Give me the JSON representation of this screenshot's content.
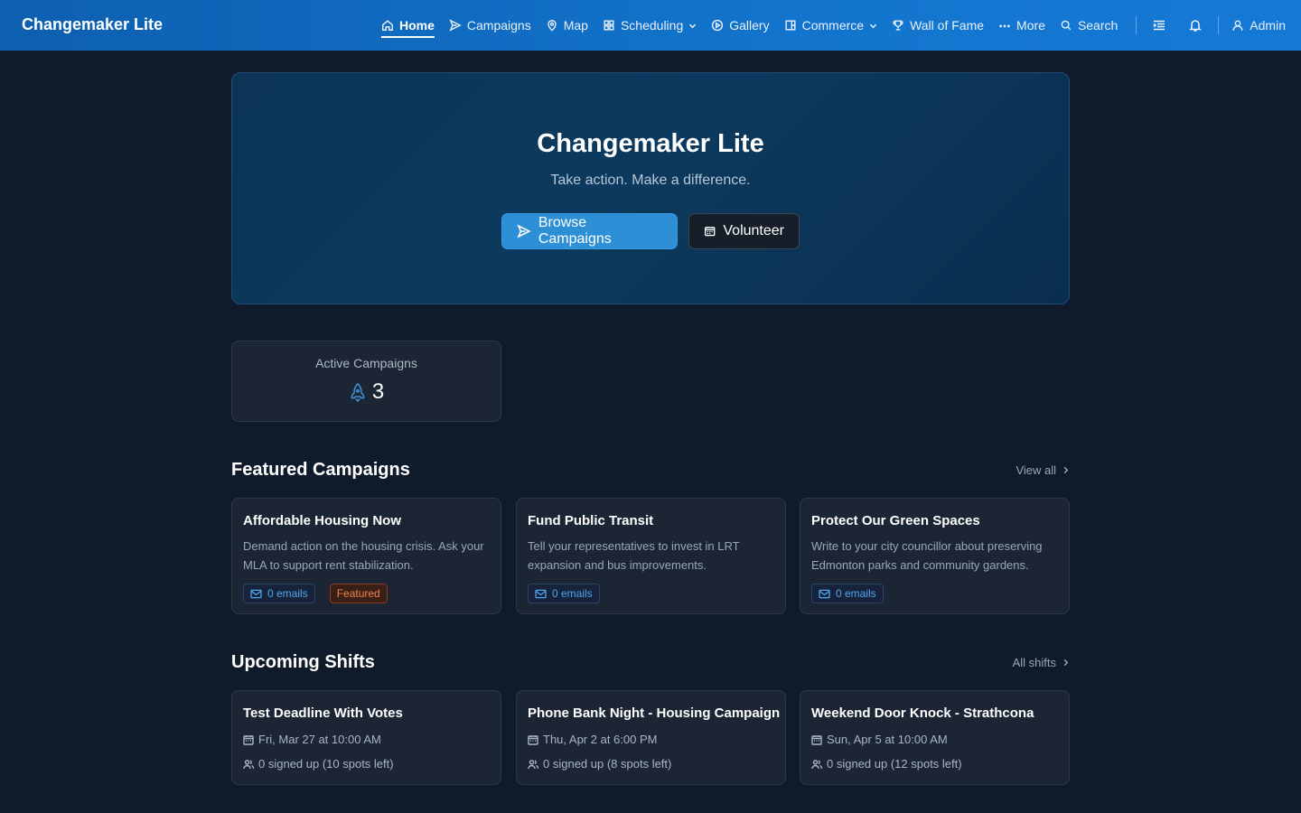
{
  "app": {
    "brand": "Changemaker Lite"
  },
  "nav": {
    "items": [
      {
        "label": "Home",
        "icon": "home-icon",
        "active": true
      },
      {
        "label": "Campaigns",
        "icon": "send-icon"
      },
      {
        "label": "Map",
        "icon": "map-pin-icon"
      },
      {
        "label": "Scheduling",
        "icon": "grid-icon",
        "dropdown": true
      },
      {
        "label": "Gallery",
        "icon": "play-circle-icon"
      },
      {
        "label": "Commerce",
        "icon": "store-icon",
        "dropdown": true
      },
      {
        "label": "Wall of Fame",
        "icon": "trophy-icon"
      },
      {
        "label": "More",
        "icon": "ellipsis-icon"
      },
      {
        "label": "Search",
        "icon": "search-icon"
      }
    ],
    "admin_label": "Admin"
  },
  "hero": {
    "title": "Changemaker Lite",
    "subtitle": "Take action. Make a difference.",
    "primary_button": "Browse Campaigns",
    "secondary_button": "Volunteer"
  },
  "stats": {
    "active_campaigns_label": "Active Campaigns",
    "active_campaigns_value": "3"
  },
  "featured": {
    "title": "Featured Campaigns",
    "view_all": "View all",
    "campaigns": [
      {
        "title": "Affordable Housing Now",
        "description": "Demand action on the housing crisis. Ask your MLA to support rent stabilization.",
        "emails": "0 emails",
        "featured": "Featured"
      },
      {
        "title": "Fund Public Transit",
        "description": "Tell your representatives to invest in LRT expansion and bus improvements.",
        "emails": "0 emails"
      },
      {
        "title": "Protect Our Green Spaces",
        "description": "Write to your city councillor about preserving Edmonton parks and community gardens.",
        "emails": "0 emails"
      }
    ]
  },
  "shifts": {
    "title": "Upcoming Shifts",
    "all_link": "All shifts",
    "items": [
      {
        "title": "Test Deadline With Votes",
        "date": "Fri, Mar 27 at 10:00 AM",
        "signups": "0 signed up (10 spots left)"
      },
      {
        "title": "Phone Bank Night - Housing Campaign",
        "date": "Thu, Apr 2 at 6:00 PM",
        "signups": "0 signed up (8 spots left)"
      },
      {
        "title": "Weekend Door Knock - Strathcona",
        "date": "Sun, Apr 5 at 10:00 AM",
        "signups": "0 signed up (12 spots left)"
      }
    ]
  },
  "colors": {
    "accent": "#2d8fd6",
    "nav_bg": "#1274cc",
    "page_bg": "#0f1a2a",
    "featured_badge": "#f0804c"
  }
}
